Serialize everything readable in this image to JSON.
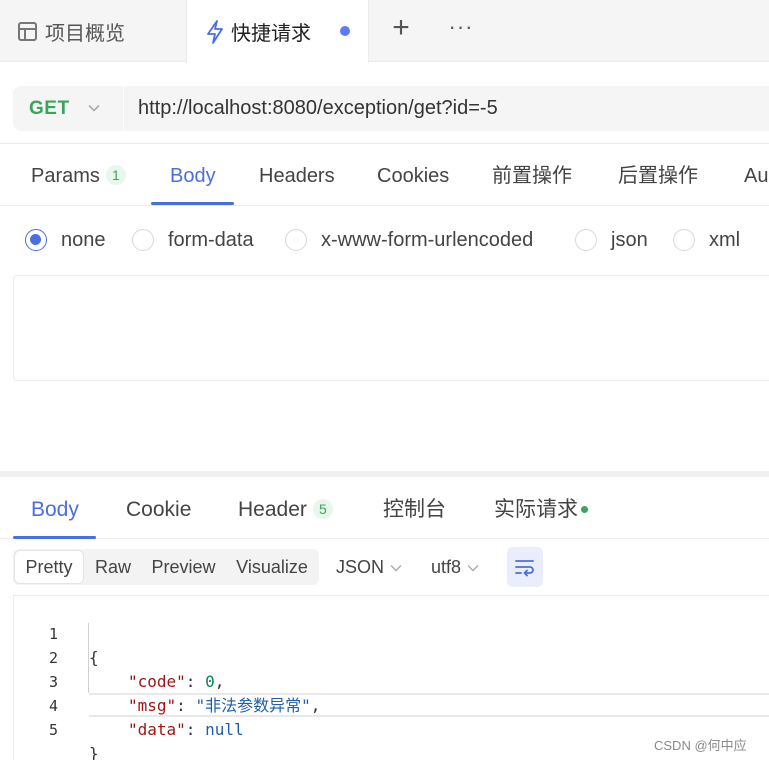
{
  "top_tabs": {
    "overview_label": "项目概览",
    "quick_request_label": "快捷请求",
    "plus_glyph": "+",
    "more_glyph": "···",
    "unsaved_dot_color": "#5b7cf5"
  },
  "url_bar": {
    "method": "GET",
    "method_color": "#3aa55b",
    "url": "http://localhost:8080/exception/get?id=-5"
  },
  "request_tabs": {
    "items": [
      {
        "label": "Params",
        "badge": "1"
      },
      {
        "label": "Body",
        "active": true
      },
      {
        "label": "Headers"
      },
      {
        "label": "Cookies"
      },
      {
        "label": "前置操作"
      },
      {
        "label": "后置操作"
      },
      {
        "label": "Au"
      }
    ]
  },
  "body_types": {
    "selected": "none",
    "options": [
      "none",
      "form-data",
      "x-www-form-urlencoded",
      "json",
      "xml"
    ]
  },
  "response_tabs": {
    "items": [
      {
        "label": "Body",
        "active": true
      },
      {
        "label": "Cookie"
      },
      {
        "label": "Header",
        "badge": "5"
      },
      {
        "label": "控制台"
      },
      {
        "label": "实际请求",
        "live_dot": true
      }
    ]
  },
  "format_toolbar": {
    "modes": [
      "Pretty",
      "Raw",
      "Preview",
      "Visualize"
    ],
    "active_mode": "Pretty",
    "language": "JSON",
    "encoding": "utf8",
    "wrap_icon": "wrap-lines-icon"
  },
  "response_body": {
    "lines": [
      {
        "n": "1",
        "text": "{"
      },
      {
        "n": "2",
        "key": "\"code\"",
        "sep": ": ",
        "value": "0",
        "tail": ","
      },
      {
        "n": "3",
        "key": "\"msg\"",
        "sep": ": ",
        "value": "\"非法参数异常\"",
        "tail": ","
      },
      {
        "n": "4",
        "key": "\"data\"",
        "sep": ": ",
        "value": "null",
        "tail": ""
      },
      {
        "n": "5",
        "text": "}"
      }
    ]
  },
  "watermark": "CSDN @何中应",
  "colors": {
    "accent": "#4a6ee0",
    "success": "#3aa55b"
  }
}
